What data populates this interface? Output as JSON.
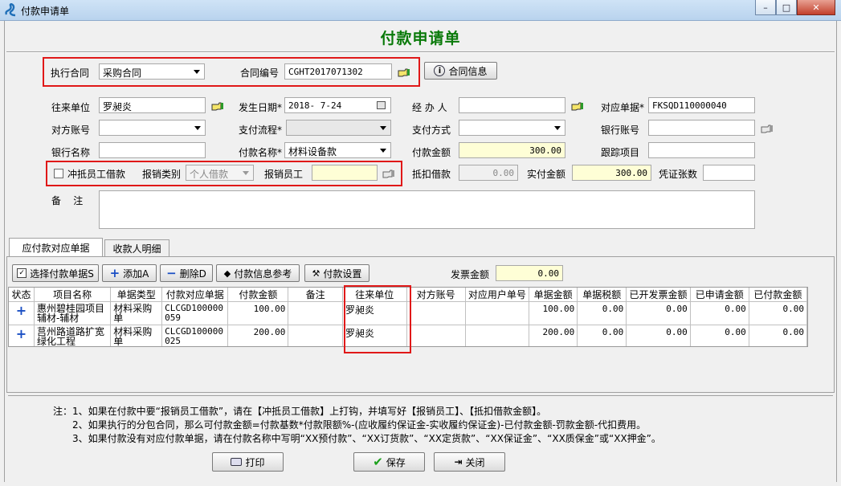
{
  "window": {
    "title": "付款申请单",
    "min": "–",
    "max": "□",
    "close": "✕"
  },
  "form_title": "付款申请单",
  "contract": {
    "exec_label": "执行合同",
    "exec_value": "采购合同",
    "no_label": "合同编号",
    "no_value": "CGHT2017071302",
    "info_button": "合同信息"
  },
  "fields": {
    "payee_label": "往来单位",
    "payee_value": "罗昶炎",
    "date_label": "发生日期*",
    "date_value": "2018- 7-24",
    "handler_label": "经 办 人",
    "handler_value": "",
    "bill_label": "对应单据*",
    "bill_value": "FKSQD110000040",
    "account_label": "对方账号",
    "account_value": "",
    "flow_label": "支付流程*",
    "flow_value": "",
    "method_label": "支付方式",
    "method_value": "",
    "bank_acc_label": "银行账号",
    "bank_acc_value": "",
    "bank_name_label": "银行名称",
    "bank_name_value": "",
    "pay_name_label": "付款名称*",
    "pay_name_value": "材料设备款",
    "amount_label": "付款金额",
    "amount_value": "300.00",
    "project_label": "跟踪项目",
    "project_value": "",
    "offset_label": "冲抵员工借款",
    "claim_type_label": "报销类别",
    "claim_type_value": "个人借款",
    "claim_emp_label": "报销员工",
    "claim_emp_value": "",
    "deduct_label": "抵扣借款",
    "deduct_value": "0.00",
    "actual_label": "实付金额",
    "actual_value": "300.00",
    "voucher_label": "凭证张数",
    "voucher_value": "",
    "remark_label": "备    注",
    "remark_value": ""
  },
  "tabs": [
    {
      "label": "应付款对应单据"
    },
    {
      "label": "收款人明细"
    }
  ],
  "toolbar": {
    "select": "选择付款单据S",
    "add": "添加A",
    "delete": "删除D",
    "ref": "付款信息参考",
    "settings": "付款设置",
    "invoice_label": "发票金额",
    "invoice_value": "0.00"
  },
  "table": {
    "columns": [
      "状态",
      "项目名称",
      "单据类型",
      "付款对应单据",
      "付款金额",
      "备注",
      "往来单位",
      "对方账号",
      "对应用户单号",
      "单据金额",
      "单据税额",
      "已开发票金额",
      "已申请金额",
      "已付款金额"
    ],
    "rows": [
      {
        "status": "+",
        "project": "惠州碧桂园项目辅材-辅材",
        "type": "材料采购单",
        "bill": "CLCGD100000059",
        "amount": "100.00",
        "remark": "",
        "payee": "罗昶炎",
        "account": "",
        "user_no": "",
        "bill_amt": "100.00",
        "tax": "0.00",
        "invoiced": "0.00",
        "applied": "0.00",
        "paid": "0.00"
      },
      {
        "status": "+",
        "project": "莒州路道路扩宽绿化工程",
        "type": "材料采购单",
        "bill": "CLCGD100000025",
        "amount": "200.00",
        "remark": "",
        "payee": "罗昶炎",
        "account": "",
        "user_no": "",
        "bill_amt": "200.00",
        "tax": "0.00",
        "invoiced": "0.00",
        "applied": "0.00",
        "paid": "0.00"
      }
    ]
  },
  "notes": [
    "注：1、如果在付款中要“报销员工借款”，请在【冲抵员工借款】上打钩，并填写好【报销员工】、【抵扣借款金额】。",
    "2、如果执行的分包合同，那么可付款金额=付款基数*付款限额%-(应收履约保证金-实收履约保证金)-已付款金额-罚款金额-代扣费用。",
    "3、如果付款没有对应付款单据，请在付款名称中写明“XX预付款”、“XX订货款”、“XX定货款”、“XX保证金”、“XX质保金”或“XX押金”。"
  ],
  "bottom": {
    "print": "打印",
    "save": "保存",
    "close": "关闭"
  },
  "colors": {
    "title_green": "#0a7a0a",
    "highlight_red": "#e01818",
    "yellow_field": "#fefed6"
  }
}
